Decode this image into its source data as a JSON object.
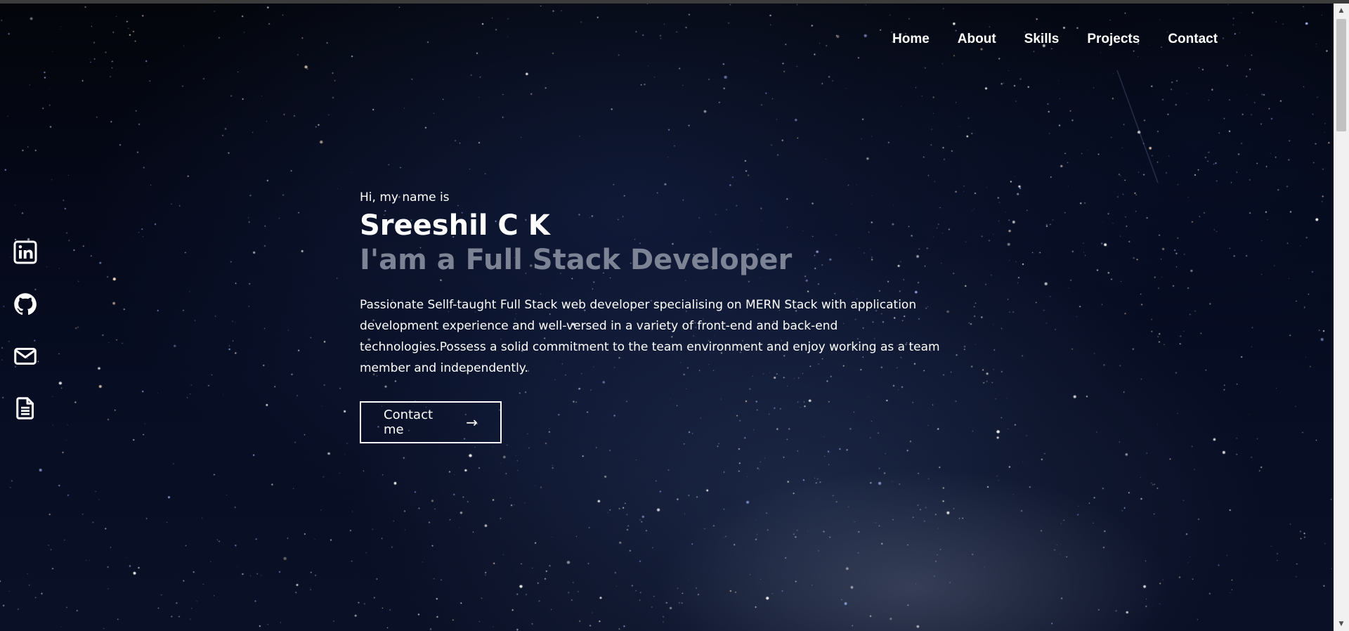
{
  "nav": {
    "items": [
      {
        "label": "Home"
      },
      {
        "label": "About"
      },
      {
        "label": "Skills"
      },
      {
        "label": "Projects"
      },
      {
        "label": "Contact"
      }
    ]
  },
  "social": {
    "icons": [
      "linkedin-icon",
      "github-icon",
      "mail-icon",
      "document-icon"
    ]
  },
  "hero": {
    "greeting": "Hi, my name is",
    "name": "Sreeshil C K",
    "role": "I'am a Full Stack Developer",
    "bio": "Passionate Sellf-taught Full Stack web developer specialising on MERN Stack with application development experience and well-versed in a variety of front-end and back-end technologies.Possess a solid commitment to the team environment and enjoy working as a team member and independently.",
    "cta_label": "Contact me",
    "cta_arrow": "→"
  },
  "colors": {
    "text": "#ffffff",
    "role_text": "#7b8394",
    "background": "#05091a"
  }
}
